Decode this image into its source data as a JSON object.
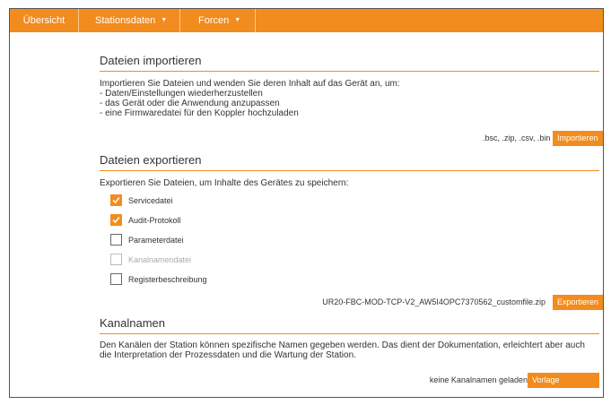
{
  "nav": {
    "items": [
      {
        "label": "Übersicht"
      },
      {
        "label": "Stationsdaten"
      },
      {
        "label": "Forcen"
      }
    ]
  },
  "import": {
    "title": "Dateien importieren",
    "intro": "Importieren Sie Dateien und wenden Sie deren Inhalt auf das Gerät an, um:",
    "bullets": [
      "- Daten/Einstellungen wiederherzustellen",
      "- das Gerät oder die Anwendung anzupassen",
      "- eine Firmwaredatei für den Koppler hochzuladen"
    ],
    "file_types": ".bsc, .zip, .csv, .bin",
    "button": "Importieren"
  },
  "export": {
    "title": "Dateien exportieren",
    "intro": "Exportieren Sie Dateien, um Inhalte des Gerätes zu speichern:",
    "options": [
      {
        "label": "Servicedatei",
        "checked": true,
        "disabled": false
      },
      {
        "label": "Audit-Protokoll",
        "checked": true,
        "disabled": false
      },
      {
        "label": "Parameterdatei",
        "checked": false,
        "disabled": false
      },
      {
        "label": "Kanalnamendatei",
        "checked": false,
        "disabled": true
      },
      {
        "label": "Registerbeschreibung",
        "checked": false,
        "disabled": false
      }
    ],
    "filename": "UR20-FBC-MOD-TCP-V2_AW5I4OPC7370562_customfile.zip",
    "button": "Exportieren"
  },
  "channels": {
    "title": "Kanalnamen",
    "description_line1": "Den Kanälen der Station können spezifische Namen gegeben werden. Das dient der Dokumentation, erleichtert aber auch",
    "description_line2": "die Interpretation der Prozessdaten und die Wartung der Station.",
    "status": "keine Kanalnamen geladen",
    "button": "Vorlage exportieren"
  },
  "colors": {
    "accent": "#f28c1e"
  }
}
